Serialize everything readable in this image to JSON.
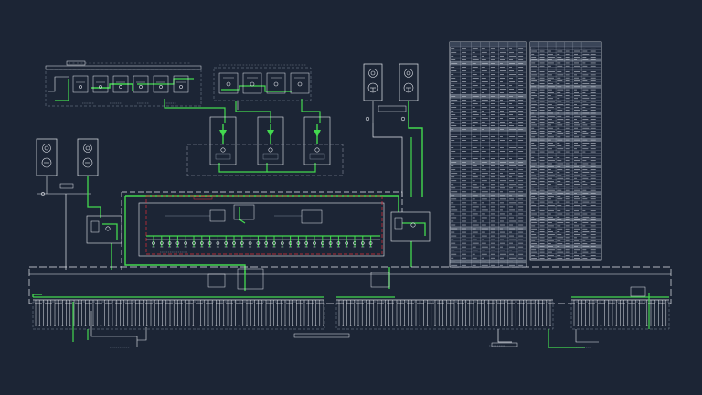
{
  "canvas": {
    "background": "#1c2535"
  },
  "colors": {
    "line": "#e6e9ef",
    "dim": "#9aa3b2",
    "green": "#43d94f",
    "red": "#e0303a",
    "table_bg": "#202a3c"
  },
  "title_blocks": {
    "left": "",
    "middle": ""
  },
  "tables": [
    {
      "name": "schedule-table-a",
      "rows": 60
    },
    {
      "name": "schedule-table-b",
      "rows": 72
    }
  ]
}
